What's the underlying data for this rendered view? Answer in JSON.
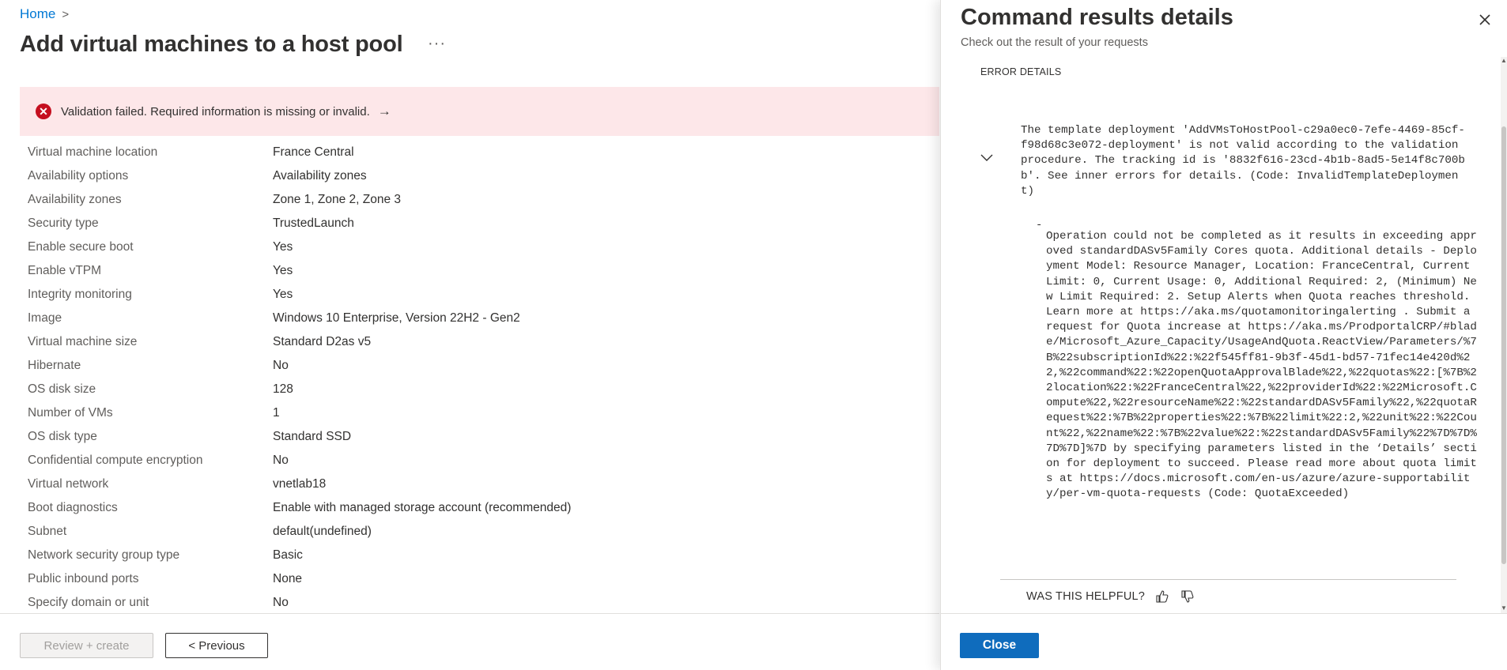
{
  "breadcrumb": {
    "home": "Home",
    "separator": ">"
  },
  "page": {
    "title": "Add virtual machines to a host pool",
    "more_label": "···"
  },
  "validation": {
    "message": "Validation failed. Required information is missing or invalid.",
    "arrow": "→",
    "icon": "error-circle-icon",
    "color": "#c50f1f"
  },
  "summary": [
    {
      "label": "Virtual machine location",
      "value": "France Central"
    },
    {
      "label": "Availability options",
      "value": "Availability zones"
    },
    {
      "label": "Availability zones",
      "value": "Zone 1, Zone 2, Zone 3"
    },
    {
      "label": "Security type",
      "value": "TrustedLaunch"
    },
    {
      "label": "Enable secure boot",
      "value": "Yes"
    },
    {
      "label": "Enable vTPM",
      "value": "Yes"
    },
    {
      "label": "Integrity monitoring",
      "value": "Yes"
    },
    {
      "label": "Image",
      "value": "Windows 10 Enterprise, Version 22H2 - Gen2"
    },
    {
      "label": "Virtual machine size",
      "value": "Standard D2as v5"
    },
    {
      "label": "Hibernate",
      "value": "No"
    },
    {
      "label": "OS disk size",
      "value": "128"
    },
    {
      "label": "Number of VMs",
      "value": "1"
    },
    {
      "label": "OS disk type",
      "value": "Standard SSD"
    },
    {
      "label": "Confidential compute encryption",
      "value": "No"
    },
    {
      "label": "Virtual network",
      "value": "vnetlab18"
    },
    {
      "label": "Boot diagnostics",
      "value": "Enable with managed storage account (recommended)"
    },
    {
      "label": "Subnet",
      "value": "default(undefined)"
    },
    {
      "label": "Network security group type",
      "value": "Basic"
    },
    {
      "label": "Public inbound ports",
      "value": "None"
    },
    {
      "label": "Specify domain or unit",
      "value": "No"
    }
  ],
  "footer": {
    "review_label": "Review + create",
    "previous_label": "< Previous"
  },
  "panel": {
    "title": "Command results details",
    "subtitle": "Check out the result of your requests",
    "error_heading": "ERROR DETAILS",
    "error_main": "The template deployment 'AddVMsToHostPool-c29a0ec0-7efe-4469-85cf-f98d68c3e072-deployment' is not valid according to the validation procedure. The tracking id is '8832f616-23cd-4b1b-8ad5-5e14f8c700bb'. See inner errors for details. (Code: InvalidTemplateDeployment)",
    "dash": "-",
    "error_inner": "Operation could not be completed as it results in exceeding approved standardDASv5Family Cores quota. Additional details - Deployment Model: Resource Manager, Location: FranceCentral, Current Limit: 0, Current Usage: 0, Additional Required: 2, (Minimum) New Limit Required: 2. Setup Alerts when Quota reaches threshold. Learn more at https://aka.ms/quotamonitoringalerting . Submit a request for Quota increase at https://aka.ms/ProdportalCRP/#blade/Microsoft_Azure_Capacity/UsageAndQuota.ReactView/Parameters/%7B%22subscriptionId%22:%22f545ff81-9b3f-45d1-bd57-71fec14e420d%22,%22command%22:%22openQuotaApprovalBlade%22,%22quotas%22:[%7B%22location%22:%22FranceCentral%22,%22providerId%22:%22Microsoft.Compute%22,%22resourceName%22:%22standardDASv5Family%22,%22quotaRequest%22:%7B%22properties%22:%7B%22limit%22:2,%22unit%22:%22Count%22,%22name%22:%7B%22value%22:%22standardDASv5Family%22%7D%7D%7D%7D]%7D by specifying parameters listed in the ‘Details’ section for deployment to succeed. Please read more about quota limits at https://docs.microsoft.com/en-us/azure/azure-supportability/per-vm-quota-requests (Code: QuotaExceeded)",
    "helpful_label": "WAS THIS HELPFUL?",
    "close_label": "Close",
    "accent_color": "#0f6cbd"
  }
}
